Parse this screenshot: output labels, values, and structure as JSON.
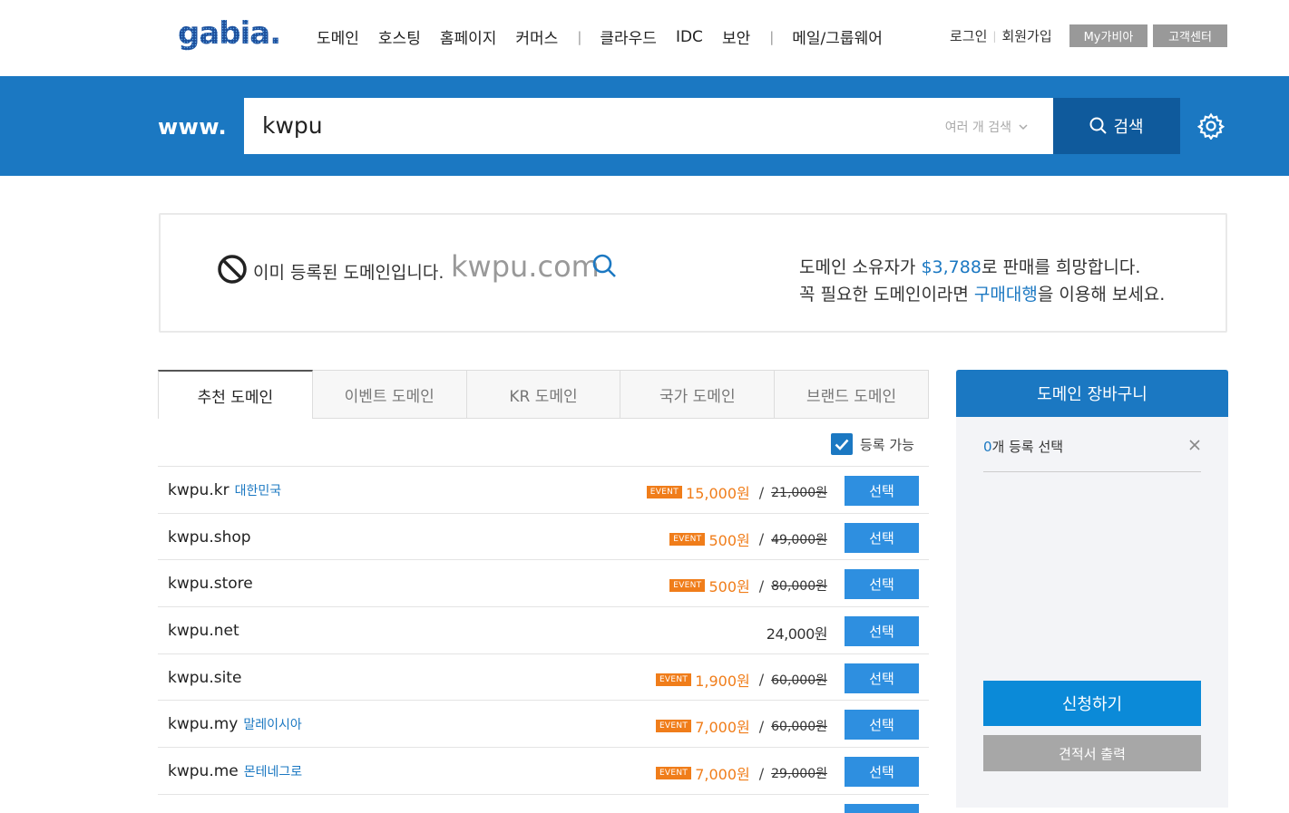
{
  "nav": {
    "logo_text": "gabia.",
    "menu": [
      "도메인",
      "호스팅",
      "홈페이지",
      "커머스",
      "클라우드",
      "IDC",
      "보안",
      "메일/그룹웨어"
    ],
    "login": "로그인",
    "signup": "회원가입",
    "mygabia": "My가비아",
    "support": "고객센터"
  },
  "search": {
    "prefix": "www.",
    "value": "kwpu",
    "multi_label": "여러 개 검색",
    "button_label": "검색"
  },
  "result": {
    "status_text": "이미 등록된 도메인입니다.",
    "domain": "kwpu.com",
    "sale_line1_a": "도메인 소유자가 ",
    "sale_price": "$3,788",
    "sale_line1_b": "로 판매를 희망합니다.",
    "sale_line2_a": "꼭 필요한 도메인이라면 ",
    "sale_link": "구매대행",
    "sale_line2_b": "을 이용해 보세요."
  },
  "tabs": [
    "추천 도메인",
    "이벤트 도메인",
    "KR 도메인",
    "국가 도메인",
    "브랜드 도메인"
  ],
  "filter_label": "등록 가능",
  "select_label": "선택",
  "event_badge": "EVENT",
  "domains": [
    {
      "name": "kwpu.kr",
      "country": "대한민국",
      "sale": "15,000원",
      "orig": "21,000원"
    },
    {
      "name": "kwpu.shop",
      "country": "",
      "sale": "500원",
      "orig": "49,000원"
    },
    {
      "name": "kwpu.store",
      "country": "",
      "sale": "500원",
      "orig": "80,000원"
    },
    {
      "name": "kwpu.net",
      "country": "",
      "price": "24,000원"
    },
    {
      "name": "kwpu.site",
      "country": "",
      "sale": "1,900원",
      "orig": "60,000원"
    },
    {
      "name": "kwpu.my",
      "country": "말레이시아",
      "sale": "7,000원",
      "orig": "60,000원"
    },
    {
      "name": "kwpu.me",
      "country": "몬테네그로",
      "sale": "7,000원",
      "orig": "29,000원"
    }
  ],
  "cart": {
    "title": "도메인 장바구니",
    "count": "0",
    "count_suffix": "개 등록 선택",
    "apply": "신청하기",
    "quote": "견적서 출력"
  },
  "colors": {
    "brand": "#1b78c2",
    "event": "#f07d1a"
  }
}
